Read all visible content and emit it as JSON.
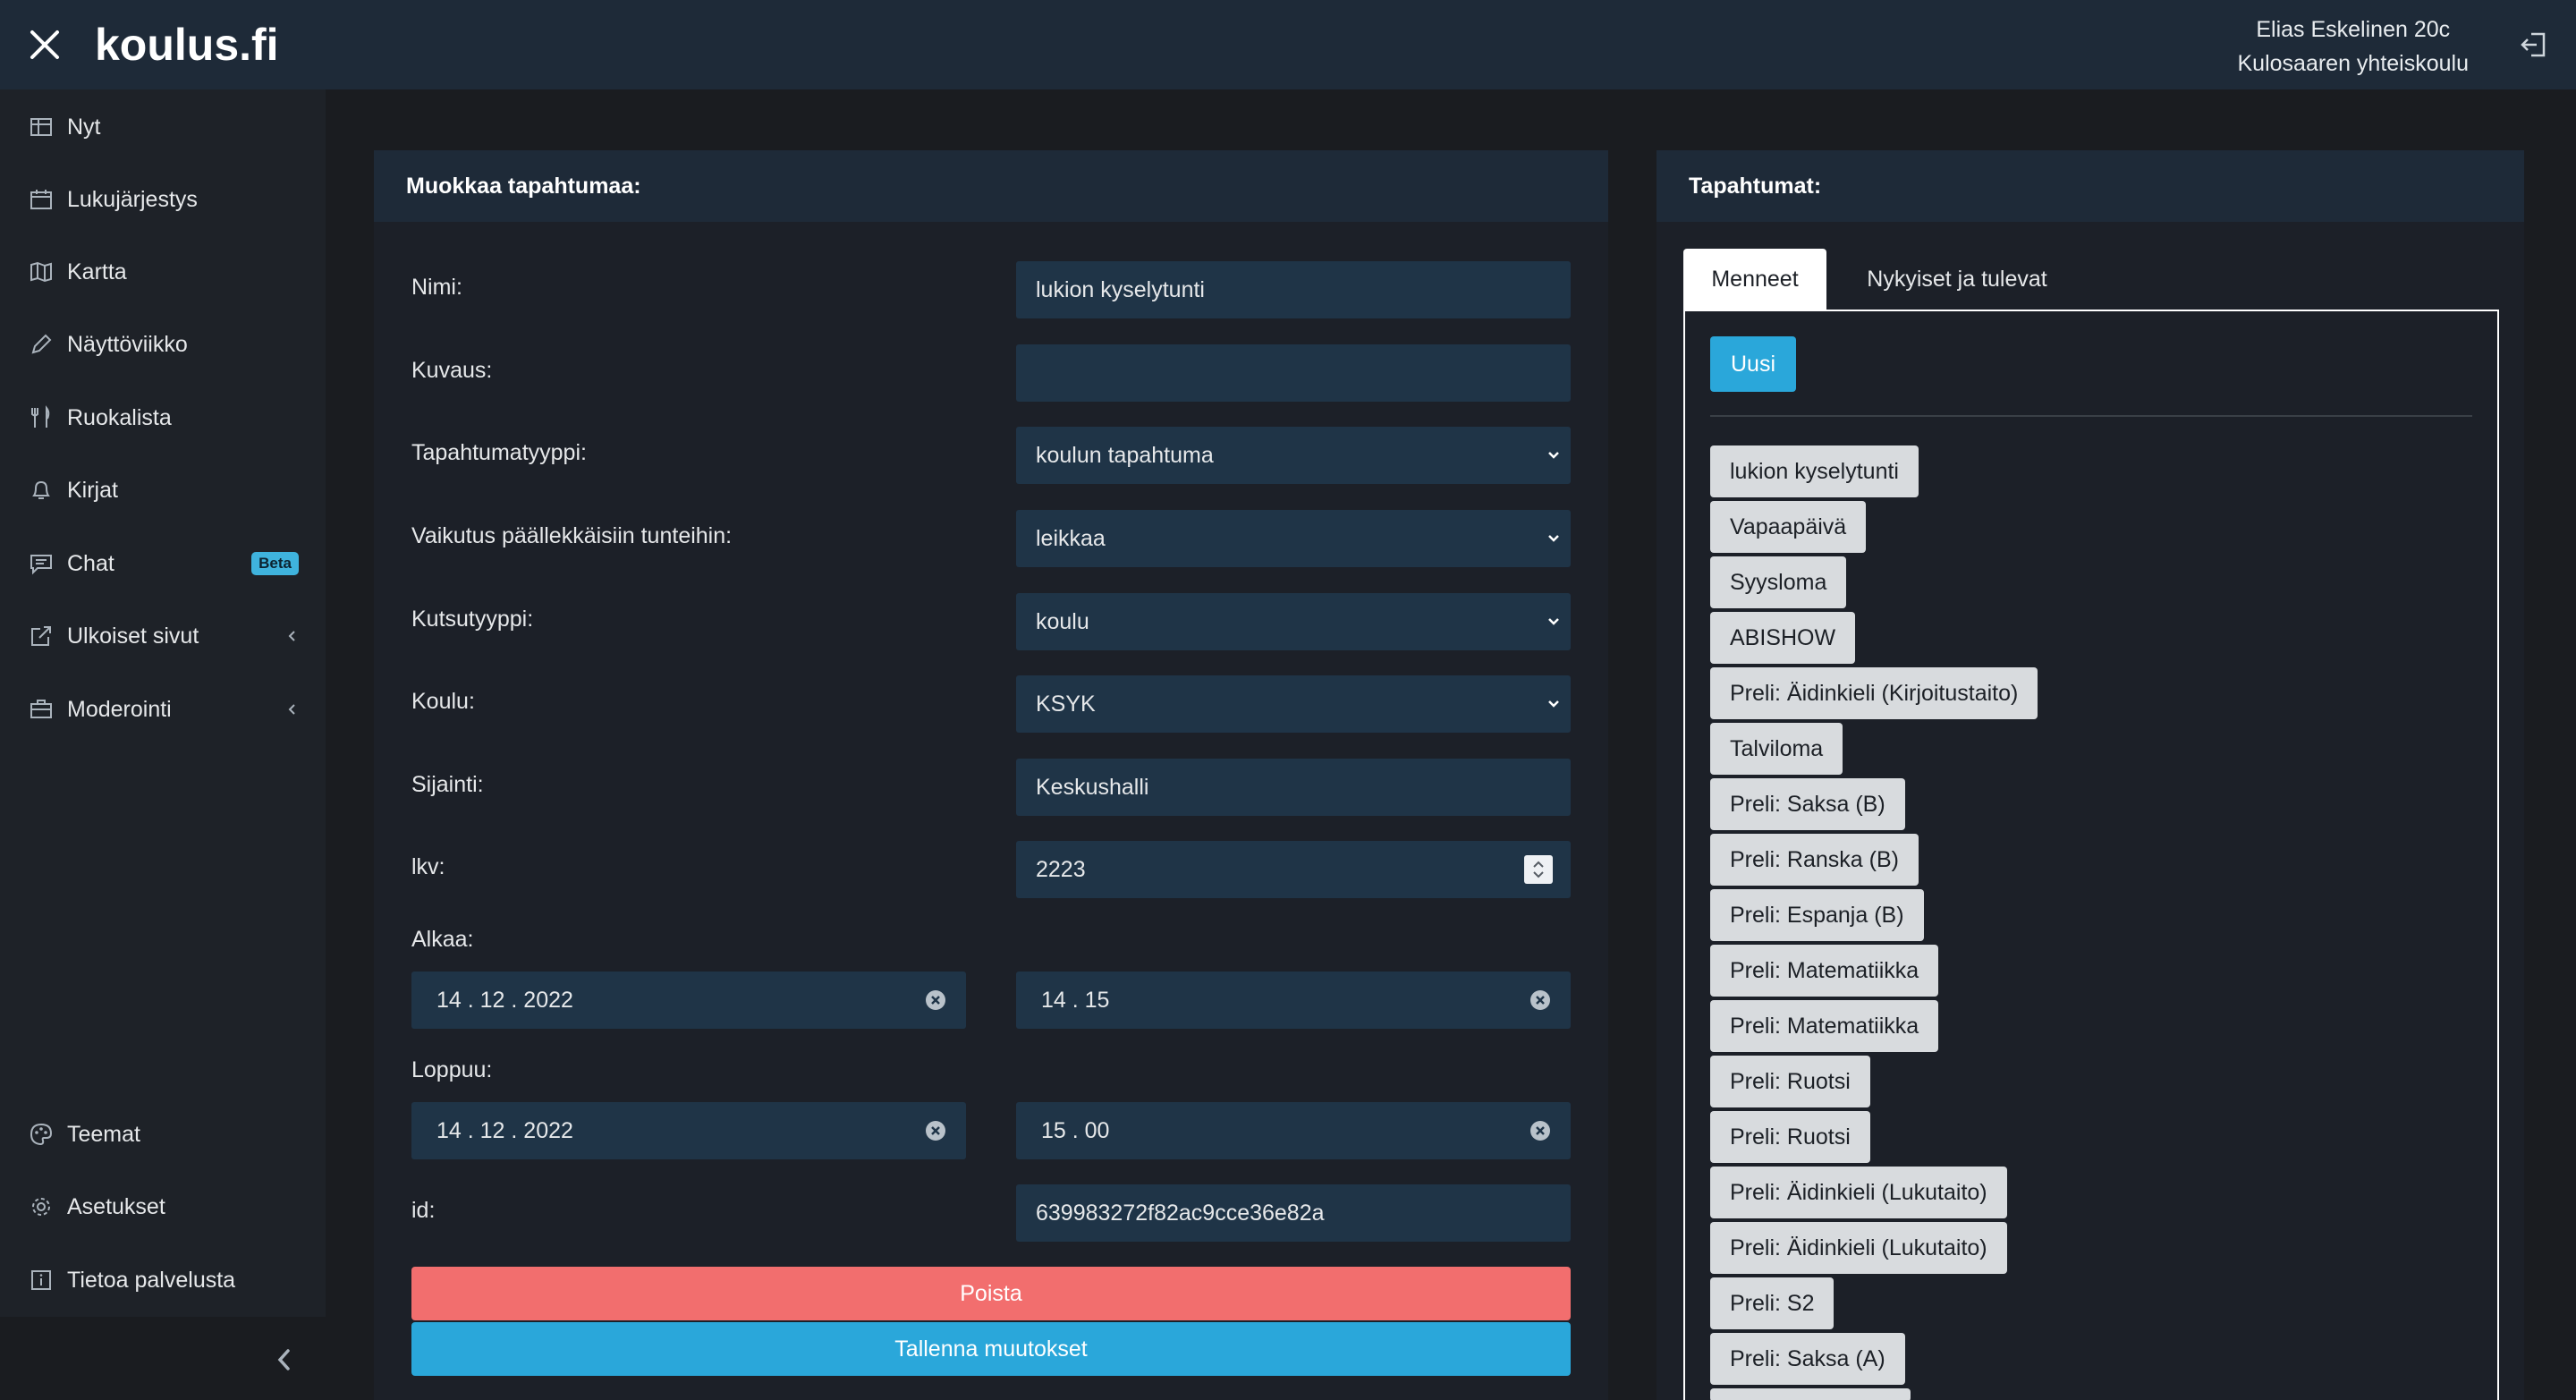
{
  "app": {
    "logo": "koulus.fi",
    "user_name": "Elias Eskelinen 20c",
    "school_name": "Kulosaaren yhteiskoulu"
  },
  "sidebar": {
    "items": [
      {
        "label": "Nyt",
        "icon": "table-icon"
      },
      {
        "label": "Lukujärjestys",
        "icon": "calendar-icon"
      },
      {
        "label": "Kartta",
        "icon": "map-icon"
      },
      {
        "label": "Näyttöviikko",
        "icon": "pencil-icon"
      },
      {
        "label": "Ruokalista",
        "icon": "cutlery-icon"
      },
      {
        "label": "Kirjat",
        "icon": "bell-icon"
      },
      {
        "label": "Chat",
        "icon": "chat-icon",
        "badge": "Beta"
      },
      {
        "label": "Ulkoiset sivut",
        "icon": "external-link-icon"
      },
      {
        "label": "Moderointi",
        "icon": "briefcase-icon"
      }
    ],
    "bottom_items": [
      {
        "label": "Teemat",
        "icon": "palette-icon"
      },
      {
        "label": "Asetukset",
        "icon": "gear-icon"
      },
      {
        "label": "Tietoa palvelusta",
        "icon": "info-icon"
      }
    ]
  },
  "edit_panel": {
    "title": "Muokkaa tapahtumaa:",
    "fields": {
      "nimi_label": "Nimi:",
      "nimi_value": "lukion kyselytunti",
      "kuvaus_label": "Kuvaus:",
      "kuvaus_value": "",
      "tyyppi_label": "Tapahtumatyyppi:",
      "tyyppi_value": "koulun tapahtuma",
      "vaikutus_label": "Vaikutus päällekkäisiin tunteihin:",
      "vaikutus_value": "leikkaa",
      "kutsu_label": "Kutsutyyppi:",
      "kutsu_value": "koulu",
      "koulu_label": "Koulu:",
      "koulu_value": "KSYK",
      "sijainti_label": "Sijainti:",
      "sijainti_value": "Keskushalli",
      "lkv_label": "lkv:",
      "lkv_value": "2223",
      "alkaa_label": "Alkaa:",
      "alkaa_date": "14 . 12 . 2022",
      "alkaa_time": "14 . 15",
      "loppuu_label": "Loppuu:",
      "loppuu_date": "14 . 12 . 2022",
      "loppuu_time": "15 . 00",
      "id_label": "id:",
      "id_value": "639983272f82ac9cce36e82a"
    },
    "delete_label": "Poista",
    "save_label": "Tallenna muutokset"
  },
  "events_panel": {
    "title": "Tapahtumat:",
    "tabs": [
      "Menneet",
      "Nykyiset ja tulevat"
    ],
    "new_label": "Uusi",
    "events": [
      "lukion kyselytunti",
      "Vapaapäivä",
      "Syysloma",
      "ABISHOW",
      "Preli: Äidinkieli (Kirjoitustaito)",
      "Talviloma",
      "Preli: Saksa (B)",
      "Preli: Ranska (B)",
      "Preli: Espanja (B)",
      "Preli: Matematiikka",
      "Preli: Matematiikka",
      "Preli: Ruotsi",
      "Preli: Ruotsi",
      "Preli: Äidinkieli (Lukutaito)",
      "Preli: Äidinkieli (Lukutaito)",
      "Preli: S2",
      "Preli: Saksa (A)"
    ]
  },
  "colors": {
    "topbar": "#1e2a38",
    "accent": "#2aa7da",
    "danger": "#f26e6e",
    "input_bg": "#1f3447"
  }
}
